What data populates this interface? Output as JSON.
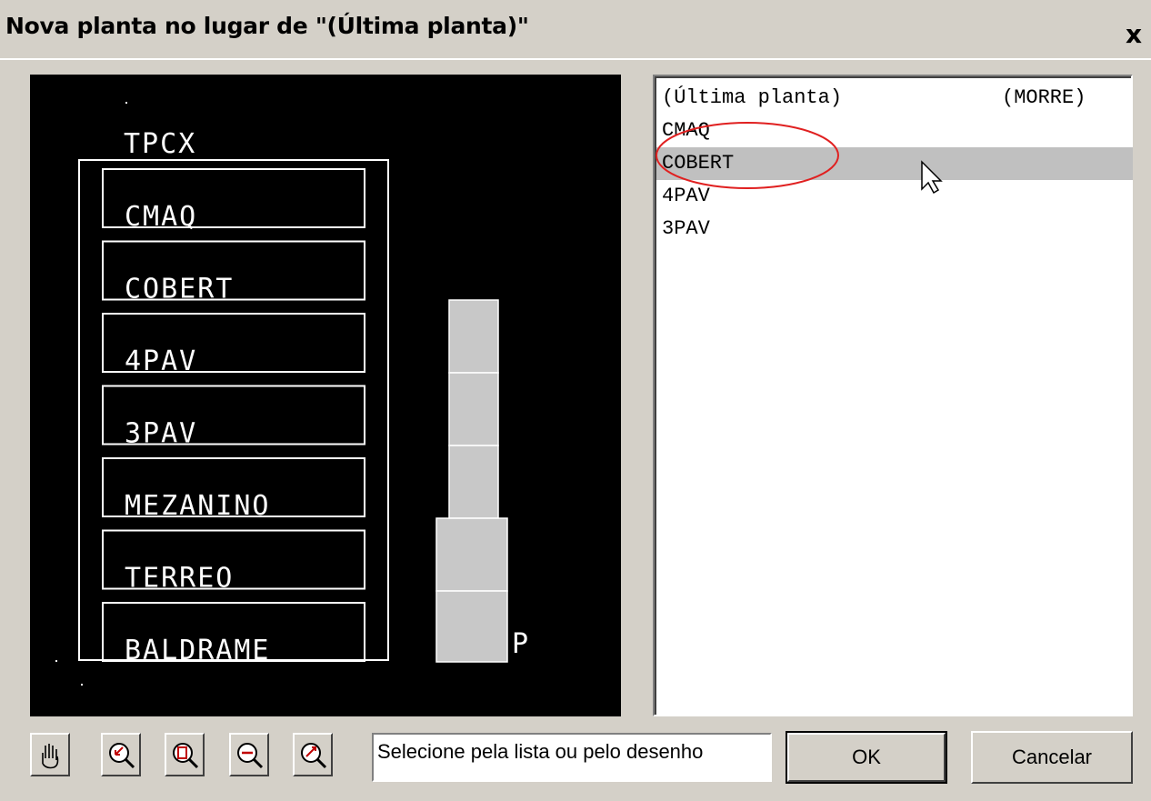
{
  "window": {
    "title": "Nova planta no lugar de \"(Última planta)\"",
    "close_label": "x"
  },
  "drawing": {
    "header_label": "TPCX",
    "floors": [
      "CMAQ",
      "COBERT",
      "4PAV",
      "3PAV",
      "MEZANINO",
      "TERREO",
      "BALDRAME"
    ],
    "side_label": "P"
  },
  "list": {
    "items": [
      {
        "name": "(Última planta)",
        "note": "(MORRE)"
      },
      {
        "name": "CMAQ",
        "note": ""
      },
      {
        "name": "COBERT",
        "note": ""
      },
      {
        "name": "4PAV",
        "note": ""
      },
      {
        "name": "3PAV",
        "note": ""
      }
    ],
    "selected_index": 2
  },
  "toolbar": {
    "tools": [
      "pan-hand-icon",
      "zoom-window-icon",
      "zoom-extents-icon",
      "zoom-out-icon",
      "zoom-realtime-icon"
    ]
  },
  "status_text": "Selecione pela lista ou pelo desenho",
  "buttons": {
    "ok_label": "OK",
    "cancel_label": "Cancelar"
  },
  "colors": {
    "dialog_bg": "#d4d0c8",
    "canvas_bg": "#000000",
    "selection": "#c0c0c0",
    "highlight_circle": "#e02020"
  }
}
